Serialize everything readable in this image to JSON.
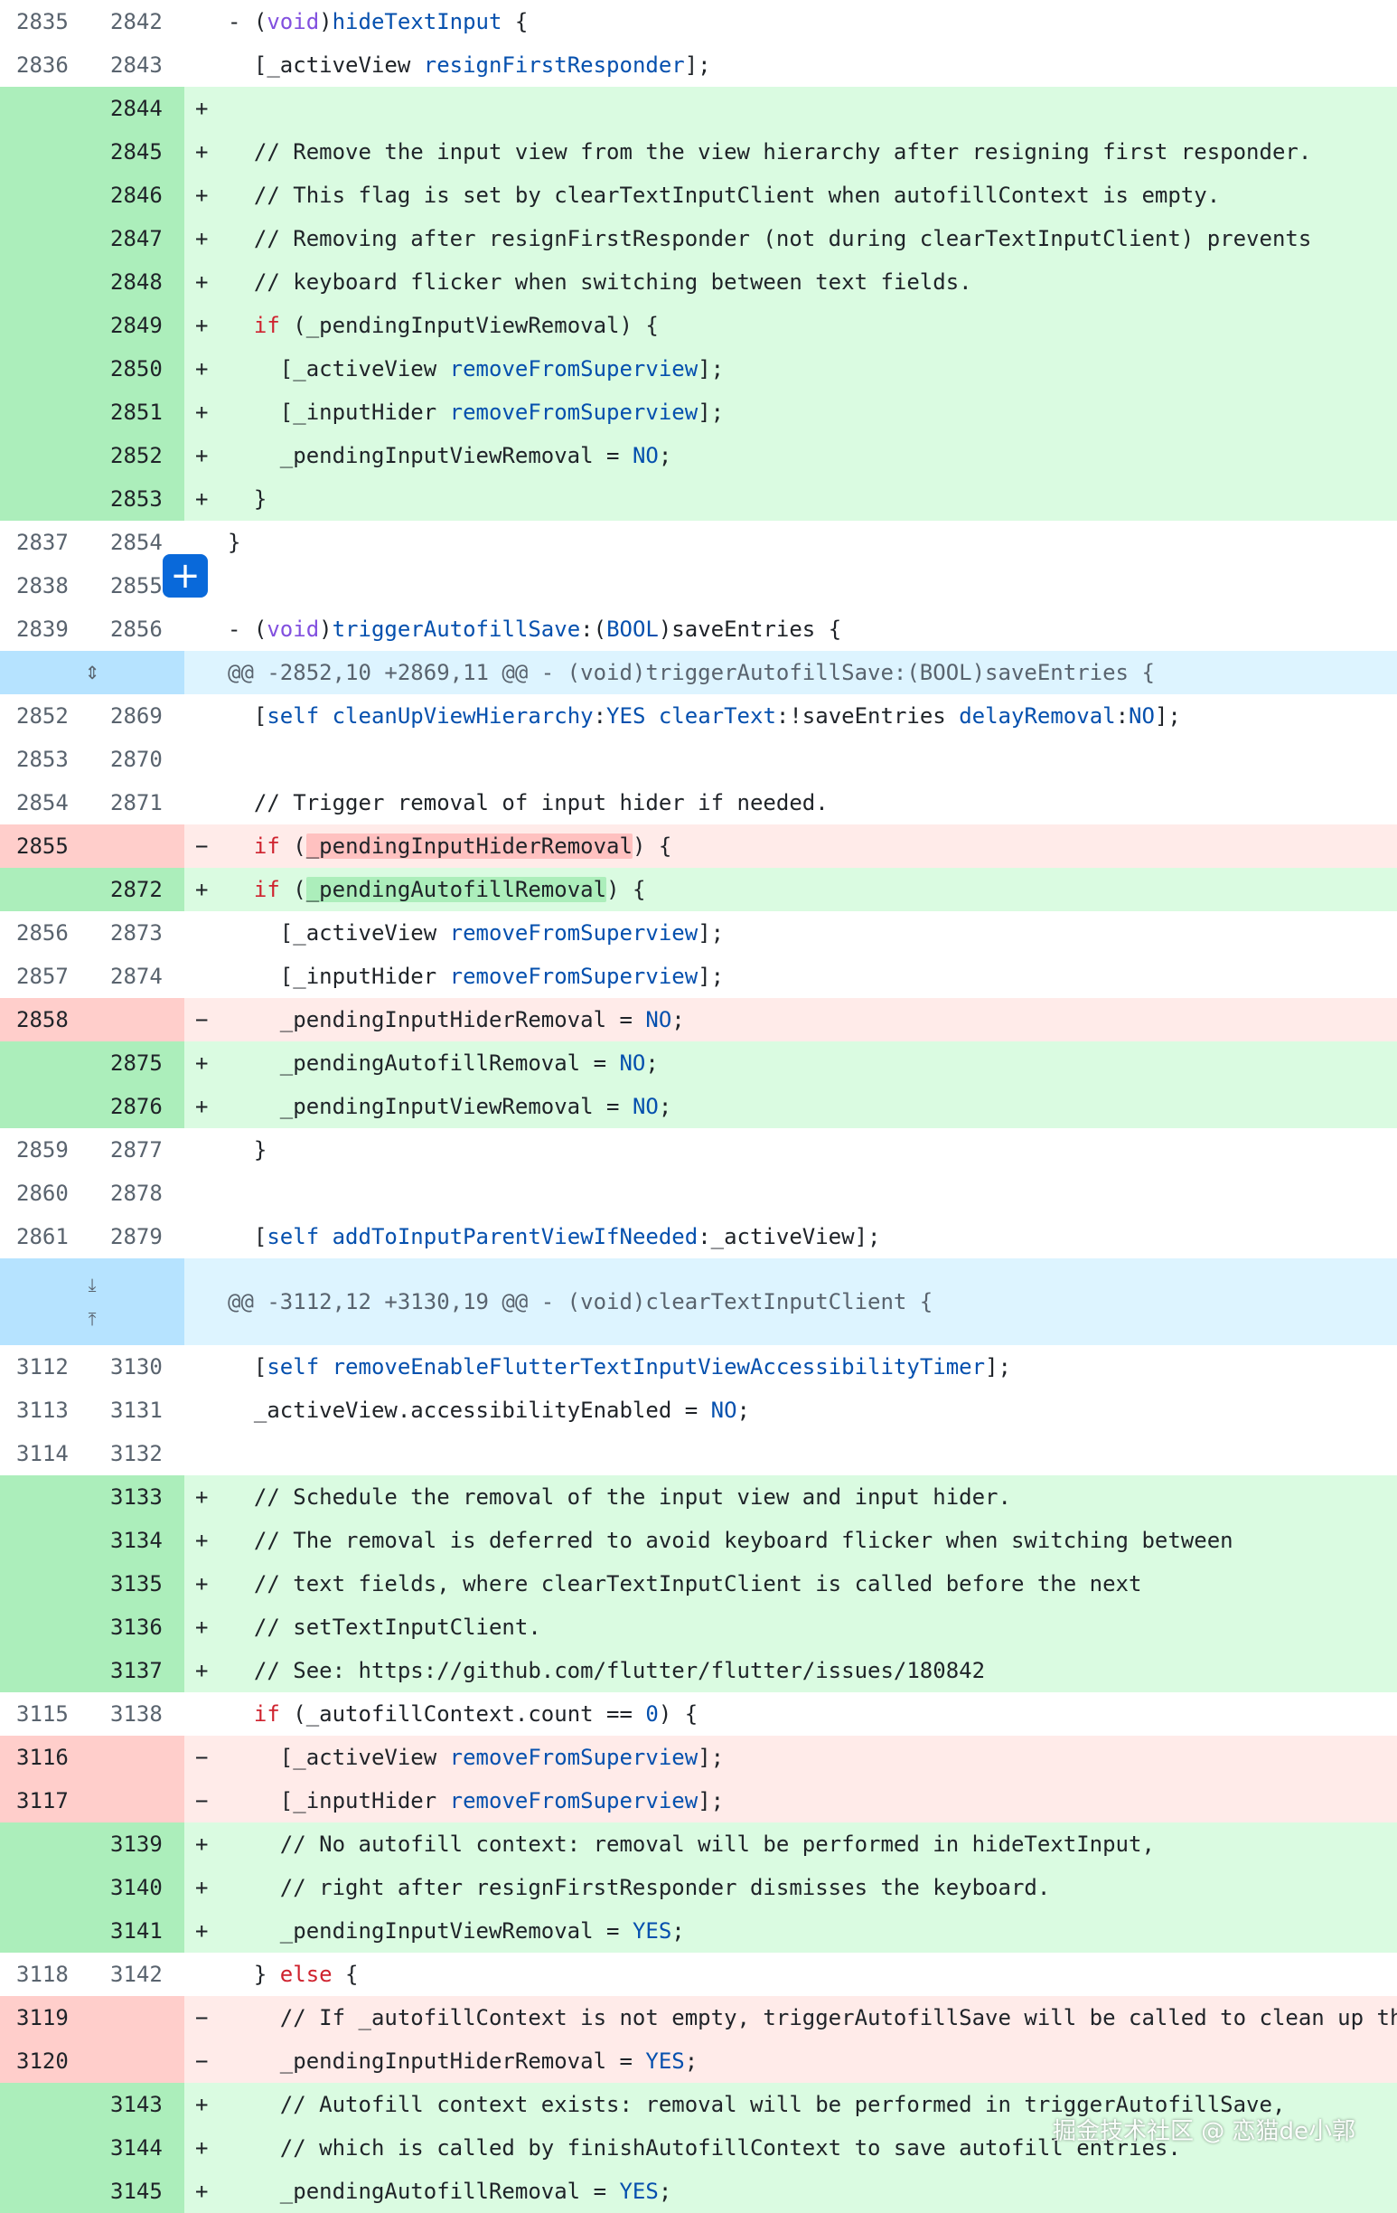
{
  "hunks": [
    "@@ -2852,10 +2869,11 @@ - (void)triggerAutofillSave:(BOOL)saveEntries {",
    "@@ -3112,12 +3130,19 @@ - (void)clearTextInputClient {"
  ],
  "rows": [
    {
      "old": "2835",
      "new": "2842",
      "sign": " ",
      "type": "ctx",
      "parts": [
        [
          "p",
          "- ("
        ],
        [
          "t",
          "void"
        ],
        [
          "p",
          ")"
        ],
        [
          "f",
          "hideTextInput"
        ],
        [
          "p",
          " {"
        ]
      ]
    },
    {
      "old": "2836",
      "new": "2843",
      "sign": " ",
      "type": "ctx",
      "parts": [
        [
          "p",
          "  [_activeView "
        ],
        [
          "f",
          "resignFirstResponder"
        ],
        [
          "p",
          "];"
        ]
      ]
    },
    {
      "old": "",
      "new": "2844",
      "sign": "+",
      "type": "add",
      "parts": []
    },
    {
      "old": "",
      "new": "2845",
      "sign": "+",
      "type": "add",
      "parts": [
        [
          "p",
          "  // Remove the input view from the view hierarchy after resigning first responder."
        ]
      ]
    },
    {
      "old": "",
      "new": "2846",
      "sign": "+",
      "type": "add",
      "parts": [
        [
          "p",
          "  // This flag is set by clearTextInputClient when autofillContext is empty."
        ]
      ]
    },
    {
      "old": "",
      "new": "2847",
      "sign": "+",
      "type": "add",
      "parts": [
        [
          "p",
          "  // Removing after resignFirstResponder (not during clearTextInputClient) prevents"
        ]
      ]
    },
    {
      "old": "",
      "new": "2848",
      "sign": "+",
      "type": "add",
      "parts": [
        [
          "p",
          "  // keyboard flicker when switching between text fields."
        ]
      ]
    },
    {
      "old": "",
      "new": "2849",
      "sign": "+",
      "type": "add",
      "parts": [
        [
          "p",
          "  "
        ],
        [
          "k",
          "if"
        ],
        [
          "p",
          " (_pendingInputViewRemoval) {"
        ]
      ]
    },
    {
      "old": "",
      "new": "2850",
      "sign": "+",
      "type": "add",
      "parts": [
        [
          "p",
          "    [_activeView "
        ],
        [
          "f",
          "removeFromSuperview"
        ],
        [
          "p",
          "];"
        ]
      ]
    },
    {
      "old": "",
      "new": "2851",
      "sign": "+",
      "type": "add",
      "parts": [
        [
          "p",
          "    [_inputHider "
        ],
        [
          "f",
          "removeFromSuperview"
        ],
        [
          "p",
          "];"
        ]
      ]
    },
    {
      "old": "",
      "new": "2852",
      "sign": "+",
      "type": "add",
      "parts": [
        [
          "p",
          "    _pendingInputViewRemoval = "
        ],
        [
          "f",
          "NO"
        ],
        [
          "p",
          ";"
        ]
      ]
    },
    {
      "old": "",
      "new": "2853",
      "sign": "+",
      "type": "add",
      "parts": [
        [
          "p",
          "  }"
        ]
      ]
    },
    {
      "old": "2837",
      "new": "2854",
      "sign": " ",
      "type": "ctx",
      "parts": [
        [
          "p",
          "}"
        ]
      ]
    },
    {
      "old": "2838",
      "new": "2855",
      "sign": " ",
      "type": "ctx",
      "parts": []
    },
    {
      "old": "2839",
      "new": "2856",
      "sign": " ",
      "type": "ctx",
      "parts": [
        [
          "p",
          "- ("
        ],
        [
          "t",
          "void"
        ],
        [
          "p",
          ")"
        ],
        [
          "f",
          "triggerAutofillSave"
        ],
        [
          "p",
          ":("
        ],
        [
          "f",
          "BOOL"
        ],
        [
          "p",
          ")saveEntries {"
        ]
      ]
    },
    {
      "hunk": 0
    },
    {
      "old": "2852",
      "new": "2869",
      "sign": " ",
      "type": "ctx",
      "parts": [
        [
          "p",
          "  ["
        ],
        [
          "f",
          "self"
        ],
        [
          "p",
          " "
        ],
        [
          "f",
          "cleanUpViewHierarchy"
        ],
        [
          "p",
          ":"
        ],
        [
          "f",
          "YES"
        ],
        [
          "p",
          " "
        ],
        [
          "f",
          "clearText"
        ],
        [
          "p",
          ":!saveEntries "
        ],
        [
          "f",
          "delayRemoval"
        ],
        [
          "p",
          ":"
        ],
        [
          "f",
          "NO"
        ],
        [
          "p",
          "];"
        ]
      ]
    },
    {
      "old": "2853",
      "new": "2870",
      "sign": " ",
      "type": "ctx",
      "parts": []
    },
    {
      "old": "2854",
      "new": "2871",
      "sign": " ",
      "type": "ctx",
      "parts": [
        [
          "p",
          "  // Trigger removal of input hider if needed."
        ]
      ]
    },
    {
      "old": "2855",
      "new": "",
      "sign": "−",
      "type": "del",
      "parts": [
        [
          "p",
          "  "
        ],
        [
          "k",
          "if"
        ],
        [
          "p",
          " ("
        ],
        [
          "hr",
          "_pendingInputHiderRemoval"
        ],
        [
          "p",
          ") {"
        ]
      ]
    },
    {
      "old": "",
      "new": "2872",
      "sign": "+",
      "type": "add",
      "parts": [
        [
          "p",
          "  "
        ],
        [
          "k",
          "if"
        ],
        [
          "p",
          " ("
        ],
        [
          "ha",
          "_pendingAutofillRemoval"
        ],
        [
          "p",
          ") {"
        ]
      ]
    },
    {
      "old": "2856",
      "new": "2873",
      "sign": " ",
      "type": "ctx",
      "parts": [
        [
          "p",
          "    [_activeView "
        ],
        [
          "f",
          "removeFromSuperview"
        ],
        [
          "p",
          "];"
        ]
      ]
    },
    {
      "old": "2857",
      "new": "2874",
      "sign": " ",
      "type": "ctx",
      "parts": [
        [
          "p",
          "    [_inputHider "
        ],
        [
          "f",
          "removeFromSuperview"
        ],
        [
          "p",
          "];"
        ]
      ]
    },
    {
      "old": "2858",
      "new": "",
      "sign": "−",
      "type": "del",
      "parts": [
        [
          "p",
          "    _pendingInputHiderRemoval = "
        ],
        [
          "f",
          "NO"
        ],
        [
          "p",
          ";"
        ]
      ]
    },
    {
      "old": "",
      "new": "2875",
      "sign": "+",
      "type": "add",
      "parts": [
        [
          "p",
          "    _pendingAutofillRemoval = "
        ],
        [
          "f",
          "NO"
        ],
        [
          "p",
          ";"
        ]
      ]
    },
    {
      "old": "",
      "new": "2876",
      "sign": "+",
      "type": "add",
      "parts": [
        [
          "p",
          "    _pendingInputViewRemoval = "
        ],
        [
          "f",
          "NO"
        ],
        [
          "p",
          ";"
        ]
      ]
    },
    {
      "old": "2859",
      "new": "2877",
      "sign": " ",
      "type": "ctx",
      "parts": [
        [
          "p",
          "  }"
        ]
      ]
    },
    {
      "old": "2860",
      "new": "2878",
      "sign": " ",
      "type": "ctx",
      "parts": []
    },
    {
      "old": "2861",
      "new": "2879",
      "sign": " ",
      "type": "ctx",
      "parts": [
        [
          "p",
          "  ["
        ],
        [
          "f",
          "self"
        ],
        [
          "p",
          " "
        ],
        [
          "f",
          "addToInputParentViewIfNeeded"
        ],
        [
          "p",
          ":_activeView];"
        ]
      ]
    },
    {
      "hunk": 1
    },
    {
      "old": "3112",
      "new": "3130",
      "sign": " ",
      "type": "ctx",
      "parts": [
        [
          "p",
          "  ["
        ],
        [
          "f",
          "self"
        ],
        [
          "p",
          " "
        ],
        [
          "f",
          "removeEnableFlutterTextInputViewAccessibilityTimer"
        ],
        [
          "p",
          "];"
        ]
      ]
    },
    {
      "old": "3113",
      "new": "3131",
      "sign": " ",
      "type": "ctx",
      "parts": [
        [
          "p",
          "  _activeView.accessibilityEnabled = "
        ],
        [
          "f",
          "NO"
        ],
        [
          "p",
          ";"
        ]
      ]
    },
    {
      "old": "3114",
      "new": "3132",
      "sign": " ",
      "type": "ctx",
      "parts": []
    },
    {
      "old": "",
      "new": "3133",
      "sign": "+",
      "type": "add",
      "parts": [
        [
          "p",
          "  // Schedule the removal of the input view and input hider."
        ]
      ]
    },
    {
      "old": "",
      "new": "3134",
      "sign": "+",
      "type": "add",
      "parts": [
        [
          "p",
          "  // The removal is deferred to avoid keyboard flicker when switching between"
        ]
      ]
    },
    {
      "old": "",
      "new": "3135",
      "sign": "+",
      "type": "add",
      "parts": [
        [
          "p",
          "  // text fields, where clearTextInputClient is called before the next"
        ]
      ]
    },
    {
      "old": "",
      "new": "3136",
      "sign": "+",
      "type": "add",
      "parts": [
        [
          "p",
          "  // setTextInputClient."
        ]
      ]
    },
    {
      "old": "",
      "new": "3137",
      "sign": "+",
      "type": "add",
      "parts": [
        [
          "p",
          "  // See: https://github.com/flutter/flutter/issues/180842"
        ]
      ]
    },
    {
      "old": "3115",
      "new": "3138",
      "sign": " ",
      "type": "ctx",
      "parts": [
        [
          "p",
          "  "
        ],
        [
          "k",
          "if"
        ],
        [
          "p",
          " (_autofillContext.count == "
        ],
        [
          "f",
          "0"
        ],
        [
          "p",
          ") {"
        ]
      ]
    },
    {
      "old": "3116",
      "new": "",
      "sign": "−",
      "type": "del",
      "parts": [
        [
          "p",
          "    [_activeView "
        ],
        [
          "f",
          "removeFromSuperview"
        ],
        [
          "p",
          "];"
        ]
      ]
    },
    {
      "old": "3117",
      "new": "",
      "sign": "−",
      "type": "del",
      "parts": [
        [
          "p",
          "    [_inputHider "
        ],
        [
          "f",
          "removeFromSuperview"
        ],
        [
          "p",
          "];"
        ]
      ]
    },
    {
      "old": "",
      "new": "3139",
      "sign": "+",
      "type": "add",
      "parts": [
        [
          "p",
          "    // No autofill context: removal will be performed in hideTextInput,"
        ]
      ]
    },
    {
      "old": "",
      "new": "3140",
      "sign": "+",
      "type": "add",
      "parts": [
        [
          "p",
          "    // right after resignFirstResponder dismisses the keyboard."
        ]
      ]
    },
    {
      "old": "",
      "new": "3141",
      "sign": "+",
      "type": "add",
      "parts": [
        [
          "p",
          "    _pendingInputViewRemoval = "
        ],
        [
          "f",
          "YES"
        ],
        [
          "p",
          ";"
        ]
      ]
    },
    {
      "old": "3118",
      "new": "3142",
      "sign": " ",
      "type": "ctx",
      "parts": [
        [
          "p",
          "  } "
        ],
        [
          "k",
          "else"
        ],
        [
          "p",
          " {"
        ]
      ]
    },
    {
      "old": "3119",
      "new": "",
      "sign": "−",
      "type": "del",
      "parts": [
        [
          "p",
          "    // If _autofillContext is not empty, triggerAutofillSave will be called to clean up th"
        ]
      ]
    },
    {
      "old": "3120",
      "new": "",
      "sign": "−",
      "type": "del",
      "parts": [
        [
          "p",
          "    _pendingInputHiderRemoval = "
        ],
        [
          "f",
          "YES"
        ],
        [
          "p",
          ";"
        ]
      ]
    },
    {
      "old": "",
      "new": "3143",
      "sign": "+",
      "type": "add",
      "parts": [
        [
          "p",
          "    // Autofill context exists: removal will be performed in triggerAutofillSave,"
        ]
      ]
    },
    {
      "old": "",
      "new": "3144",
      "sign": "+",
      "type": "add",
      "parts": [
        [
          "p",
          "    // which is called by finishAutofillContext to save autofill entries."
        ]
      ]
    },
    {
      "old": "",
      "new": "3145",
      "sign": "+",
      "type": "add",
      "parts": [
        [
          "p",
          "    _pendingAutofillRemoval = "
        ],
        [
          "f",
          "YES"
        ],
        [
          "p",
          ";"
        ]
      ]
    }
  ],
  "add_line_button": {
    "label": "+"
  },
  "icons": {
    "expand_both": "expand-both-icon",
    "expand_up": "expand-up-icon",
    "expand_down": "expand-down-icon"
  },
  "watermark": "掘金技术社区 @ 恋猫de小郭",
  "colors": {
    "add_bg": "#dafbe1",
    "add_gutter": "#aceebb",
    "del_bg": "#ffebe9",
    "del_gutter": "#ffcecb",
    "hunk_bg": "#ddf4ff",
    "hunk_gutter": "#b6e3ff",
    "keyword": "#cf222e",
    "function": "#0550ae",
    "type": "#8250df",
    "accent": "#0969da"
  }
}
